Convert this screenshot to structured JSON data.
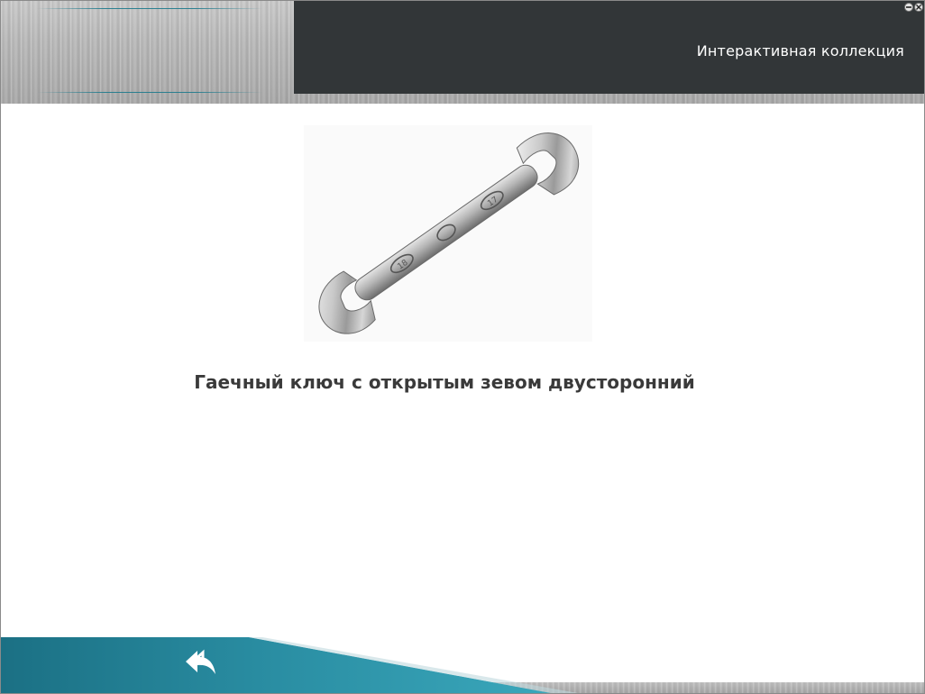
{
  "header": {
    "title": "Интерактивная коллекция",
    "minimize_icon": "minimize-icon",
    "close_icon": "close-icon"
  },
  "main": {
    "image_subject": "wrench-photo",
    "caption": "Гаечный ключ с открытым зевом двусторонний"
  },
  "footer": {
    "back_icon": "back-arrow-icon"
  },
  "colors": {
    "title_panel": "#323638",
    "accent_teal": "#1d7a8c",
    "caption_text": "#3a3a3a"
  }
}
